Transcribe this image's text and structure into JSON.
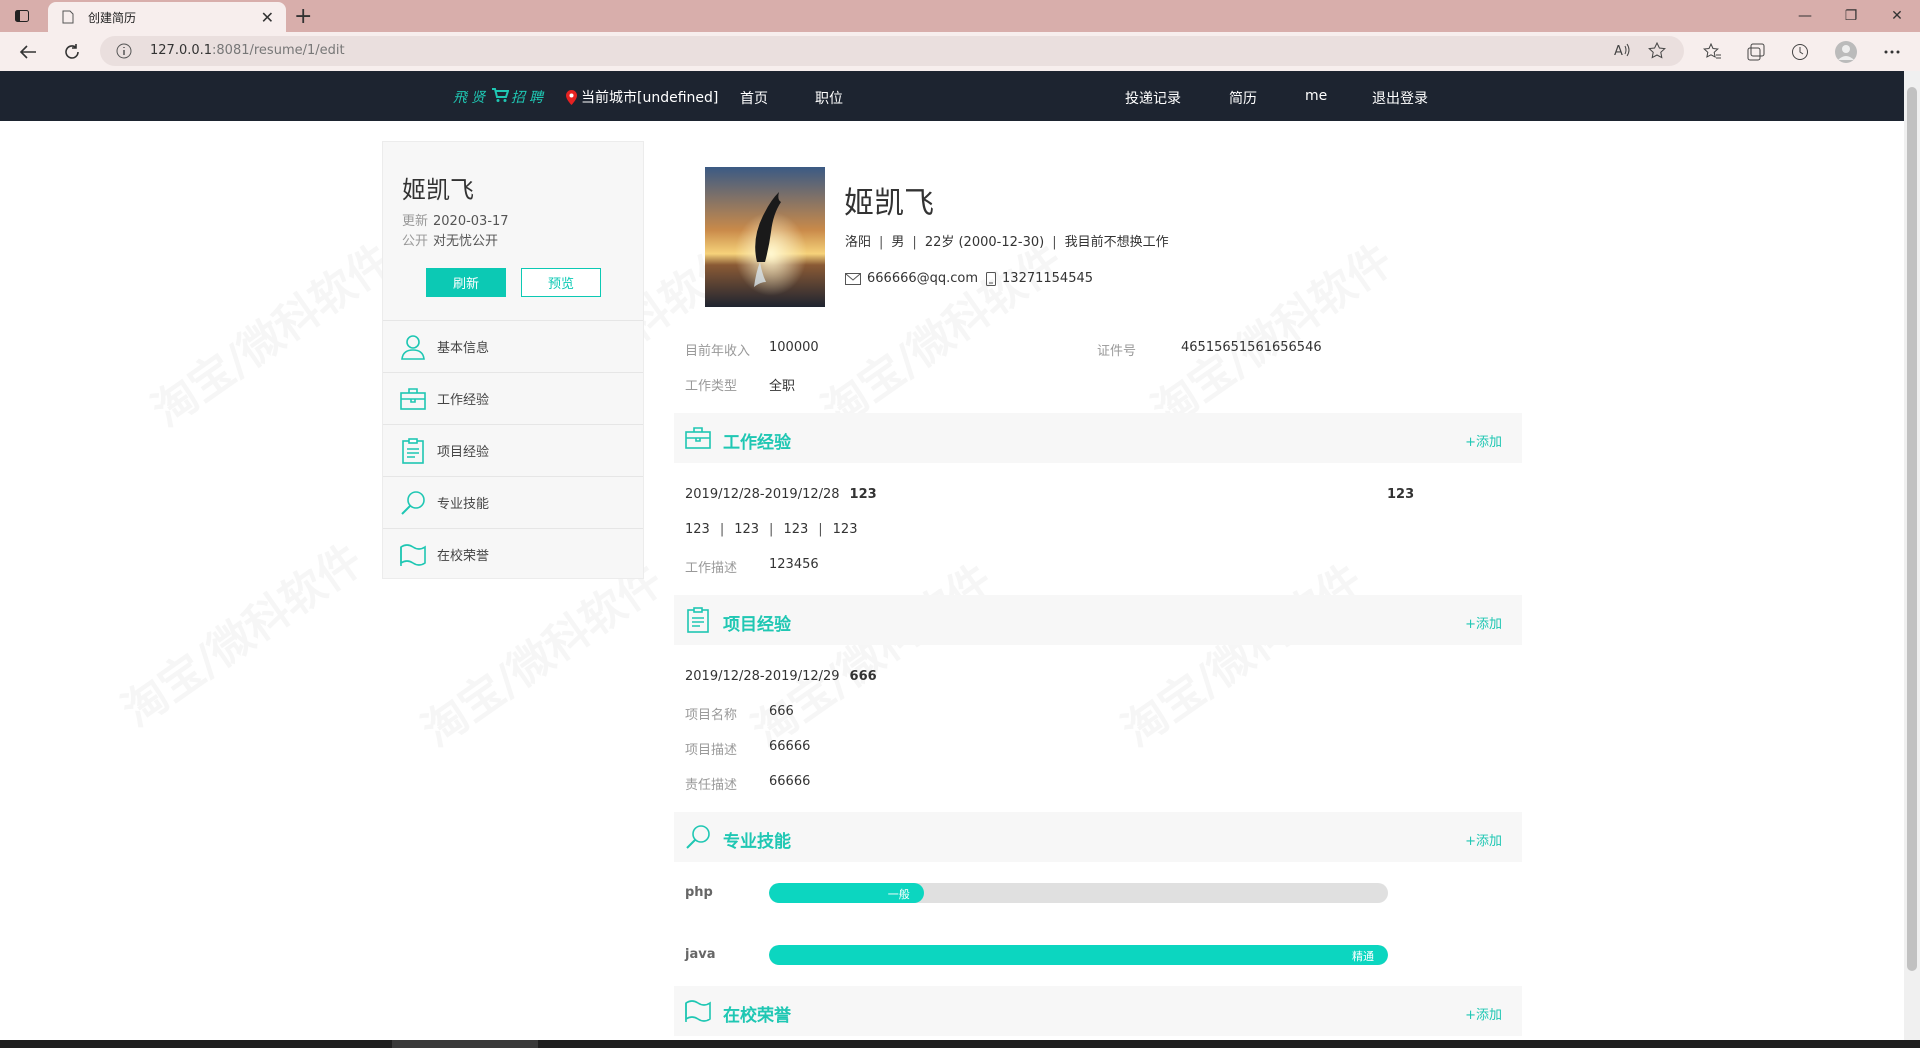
{
  "browser": {
    "tab_title": "创建简历",
    "url_host": "127.0.0.1",
    "url_rest": ":8081/resume/1/edit"
  },
  "site": {
    "logo": "飛贤",
    "logo2": "招聘",
    "city": "当前城市[undefined]",
    "nav": {
      "home": "首页",
      "jobs": "职位",
      "records": "投递记录",
      "resume": "简历",
      "me": "me",
      "logout": "退出登录"
    }
  },
  "sidebar": {
    "name": "姬凯飞",
    "updated_label": "更新",
    "updated_value": "2020-03-17",
    "public_label": "公开",
    "public_value": "对无忧公开",
    "refresh": "刷新",
    "preview": "预览",
    "items": [
      {
        "label": "基本信息",
        "icon": "user-icon"
      },
      {
        "label": "工作经验",
        "icon": "briefcase-icon"
      },
      {
        "label": "项目经验",
        "icon": "clipboard-icon"
      },
      {
        "label": "专业技能",
        "icon": "search-icon"
      },
      {
        "label": "在校荣誉",
        "icon": "flag-icon"
      }
    ]
  },
  "profile": {
    "name": "姬凯飞",
    "city": "洛阳",
    "gender": "男",
    "age": "22岁 (2000-12-30)",
    "status": "我目前不想换工作",
    "email": "666666@qq.com",
    "phone": "13271154545",
    "income_label": "目前年收入",
    "income_value": "100000",
    "id_label": "证件号",
    "id_value": "46515651561656546",
    "jobtype_label": "工作类型",
    "jobtype_value": "全职"
  },
  "work": {
    "title": "工作经验",
    "add": "+添加",
    "date": "2019/12/28-2019/12/28",
    "company": "123",
    "position": "123",
    "f1": "123",
    "f2": "123",
    "f3": "123",
    "f4": "123",
    "desc_label": "工作描述",
    "desc_value": "123456"
  },
  "project": {
    "title": "项目经验",
    "add": "+添加",
    "date": "2019/12/28-2019/12/29",
    "name": "666",
    "name_label": "项目名称",
    "name_value": "666",
    "desc_label": "项目描述",
    "desc_value": "66666",
    "duty_label": "责任描述",
    "duty_value": "66666"
  },
  "skills": {
    "title": "专业技能",
    "add": "+添加",
    "items": [
      {
        "name": "php",
        "level": "一般",
        "percent": 25
      },
      {
        "name": "java",
        "level": "精通",
        "percent": 100
      }
    ]
  },
  "honors": {
    "title": "在校荣誉",
    "add": "+添加"
  },
  "watermark": "淘宝/微科软件",
  "colors": {
    "accent": "#1fc7b3",
    "button": "#0cc9b4",
    "navbar": "#1d2430"
  }
}
